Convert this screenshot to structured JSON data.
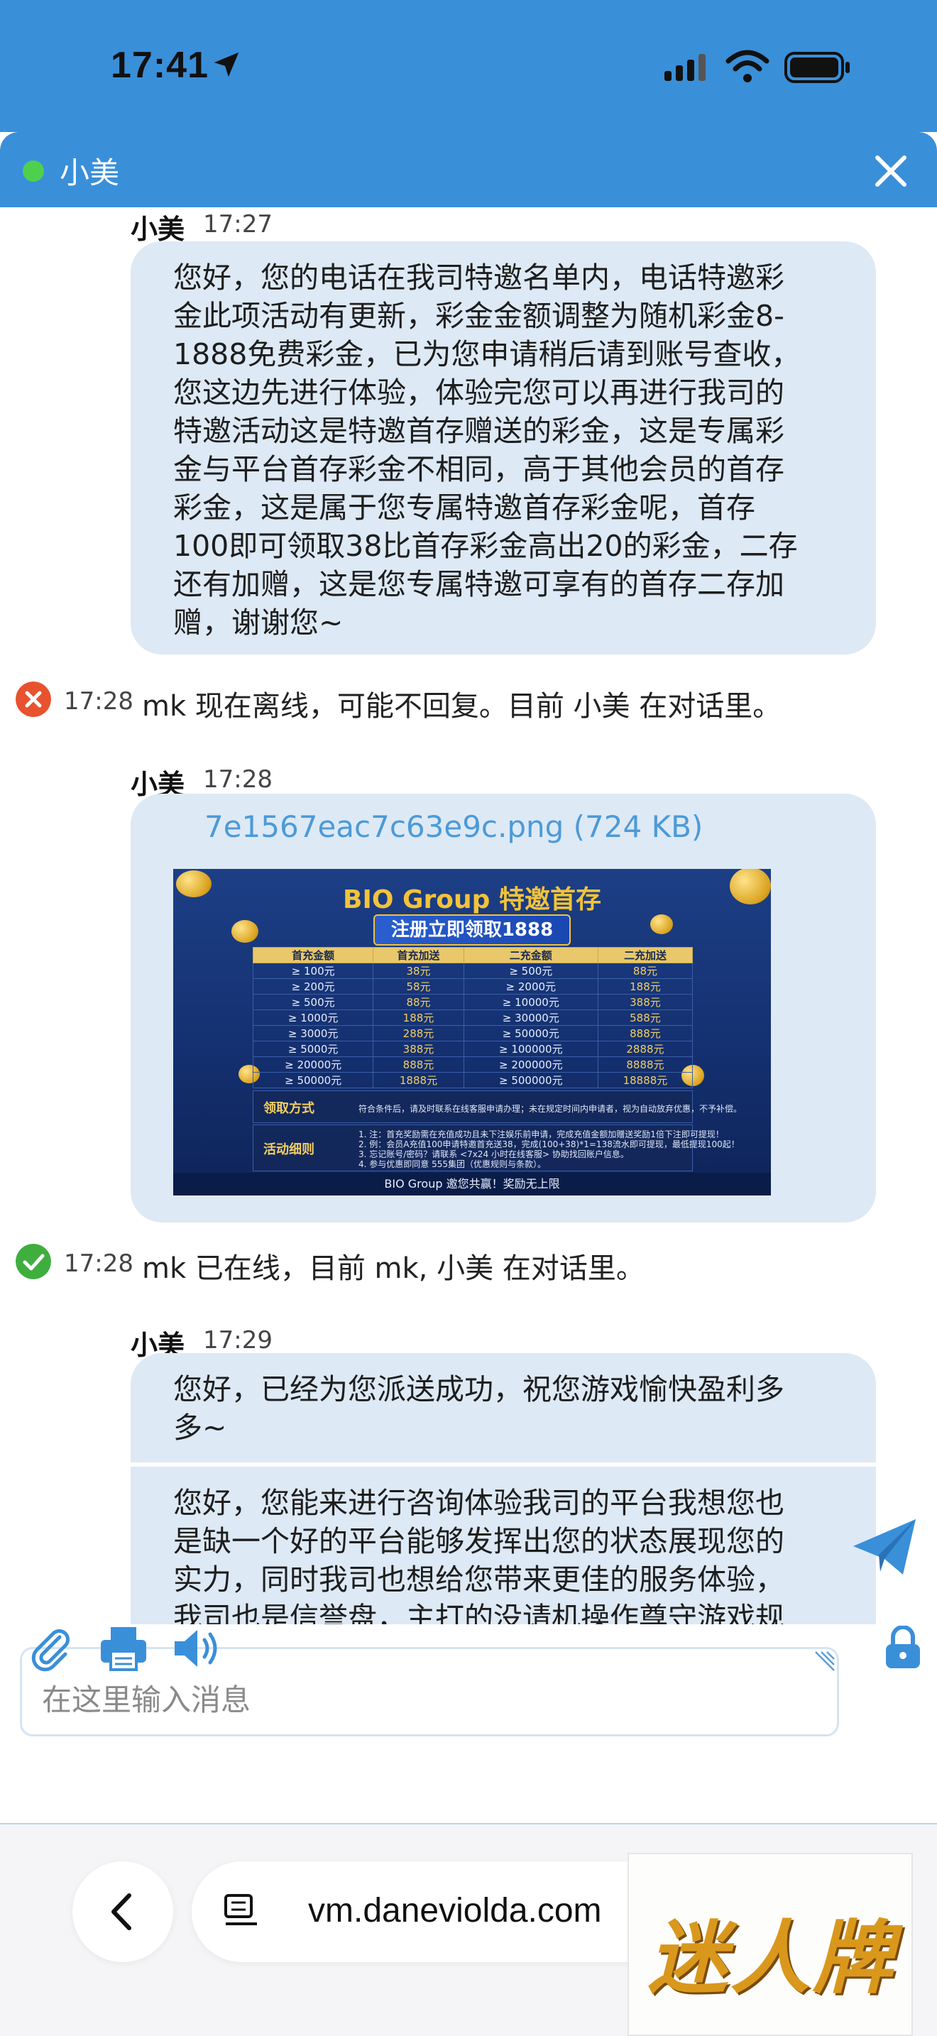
{
  "status_bar": {
    "time": "17:41"
  },
  "chat": {
    "agent_name": "小美",
    "messages": {
      "m1": {
        "sender": "小美",
        "time": "17:27",
        "lines": [
          "您好，您的电话在我司特邀名单内，电话特邀彩",
          "金此项活动有更新，彩金金额调整为随机彩金8-",
          "1888免费彩金，已为您申请稍后请到账号查收，",
          "您这边先进行体验，体验完您可以再进行我司的",
          "特邀活动这是特邀首存赠送的彩金，这是专属彩",
          "金与平台首存彩金不相同，高于其他会员的首存",
          "彩金，这是属于您专属特邀首存彩金呢，首存",
          "100即可领取38比首存彩金高出20的彩金，二存",
          "还有加赠，这是您专属特邀可享有的首存二存加",
          "赠，谢谢您~"
        ]
      },
      "sys1": {
        "time": "17:28",
        "text": "mk 现在离线，可能不回复。目前 小美 在对话里。"
      },
      "m2": {
        "sender": "小美",
        "time": "17:28",
        "file_name": "7e1567eac7c63e9c.png (724 KB)",
        "promo": {
          "title": "BIO Group 特邀首存",
          "ribbon": "注册立即领取1888",
          "headers": [
            "首充金额",
            "首充加送",
            "二充金额",
            "二充加送"
          ],
          "rows": [
            [
              "≥ 100元",
              "38元",
              "≥ 500元",
              "88元"
            ],
            [
              "≥ 200元",
              "58元",
              "≥ 2000元",
              "188元"
            ],
            [
              "≥ 500元",
              "88元",
              "≥ 10000元",
              "388元"
            ],
            [
              "≥ 1000元",
              "188元",
              "≥ 30000元",
              "588元"
            ],
            [
              "≥ 3000元",
              "288元",
              "≥ 50000元",
              "888元"
            ],
            [
              "≥ 5000元",
              "388元",
              "≥ 100000元",
              "2888元"
            ],
            [
              "≥ 20000元",
              "888元",
              "≥ 200000元",
              "8888元"
            ],
            [
              "≥ 50000元",
              "1888元",
              "≥ 500000元",
              "18888元"
            ]
          ],
          "claim_label": "领取方式",
          "claim_desc": "符合条件后，请及时联系在线客服申请办理；未在规定时间内申请者，视为自动放弃优惠，不予补偿。",
          "rules_label": "活动细则",
          "rules_desc": [
            "1. 注：首充奖励需在充值成功且未下注娱乐前申请，完成充值金额加赠送奖励1倍下注即可提现！",
            "2. 例：会员A充值100申请特邀首充送38，完成(100+38)*1=138流水即可提现，最低提现100起！",
            "3. 忘记账号/密码？请联系 <7x24 小时在线客服> 协助找回账户信息。",
            "4. 参与优惠即同意 555集团（优惠规则与条款）。"
          ],
          "footer": "BIO Group 邀您共赢！奖励无上限"
        }
      },
      "sys2": {
        "time": "17:28",
        "text": "mk 已在线，目前 mk, 小美 在对话里。"
      },
      "m3": {
        "sender": "小美",
        "time": "17:29",
        "lines": [
          "您好，已经为您派送成功，祝您游戏愉快盈利多",
          "多~"
        ]
      },
      "m4": {
        "lines": [
          "您好，您能来进行咨询体验我司的平台我想您也",
          "是缺一个好的平台能够发挥出您的状态展现您的",
          "实力，同时我司也想给您带来更佳的服务体验，",
          "我司也是信誉盘，主打的没请机操作尊守游戏规"
        ]
      }
    },
    "composer": {
      "placeholder": "在这里输入消息"
    }
  },
  "browser": {
    "url": "vm.daneviolda.com"
  },
  "watermark": {
    "text": "迷人牌"
  },
  "colors": {
    "accent": "#3a8fd9",
    "bubble": "#dde9f5",
    "online": "#4ed04e",
    "offline": "#e8522f",
    "link": "#4c9ad8"
  }
}
